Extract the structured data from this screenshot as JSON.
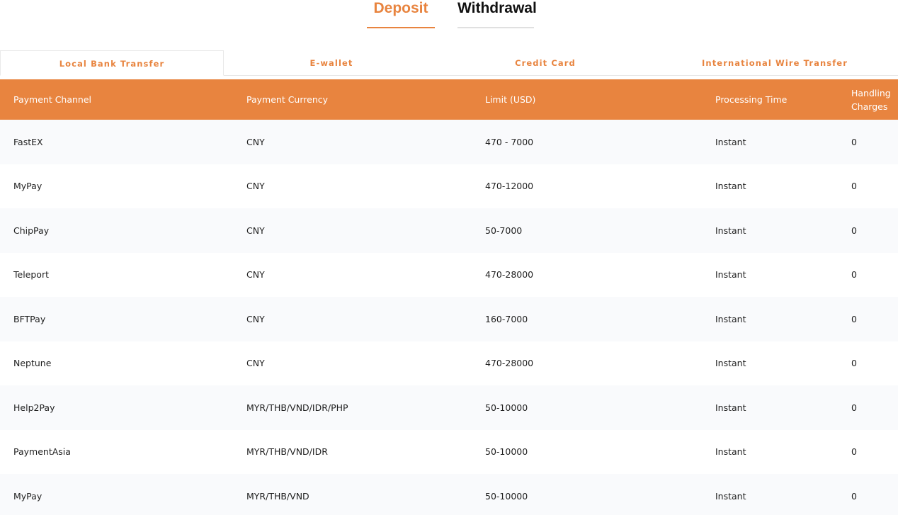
{
  "top_tabs": {
    "deposit": "Deposit",
    "withdrawal": "Withdrawal"
  },
  "sub_tabs": [
    "Local Bank Transfer",
    "E-wallet",
    "Credit Card",
    "International Wire Transfer"
  ],
  "table": {
    "headers": [
      "Payment Channel",
      "Payment Currency",
      "Limit (USD)",
      "Processing Time",
      "Handling Charges"
    ],
    "rows": [
      [
        "FastEX",
        "CNY",
        "470 - 7000",
        "Instant",
        "0"
      ],
      [
        "MyPay",
        "CNY",
        "470-12000",
        "Instant",
        "0"
      ],
      [
        "ChipPay",
        "CNY",
        "50-7000",
        "Instant",
        "0"
      ],
      [
        "Teleport",
        "CNY",
        "470-28000",
        "Instant",
        "0"
      ],
      [
        "BFTPay",
        "CNY",
        "160-7000",
        "Instant",
        "0"
      ],
      [
        "Neptune",
        "CNY",
        "470-28000",
        "Instant",
        "0"
      ],
      [
        "Help2Pay",
        "MYR/THB/VND/IDR/PHP",
        "50-10000",
        "Instant",
        "0"
      ],
      [
        "PaymentAsia",
        "MYR/THB/VND/IDR",
        "50-10000",
        "Instant",
        "0"
      ],
      [
        "MyPay",
        "MYR/THB/VND",
        "50-10000",
        "Instant",
        "0"
      ]
    ]
  },
  "colors": {
    "accent": "#e8843f",
    "row_alt": "#f9fafc"
  }
}
